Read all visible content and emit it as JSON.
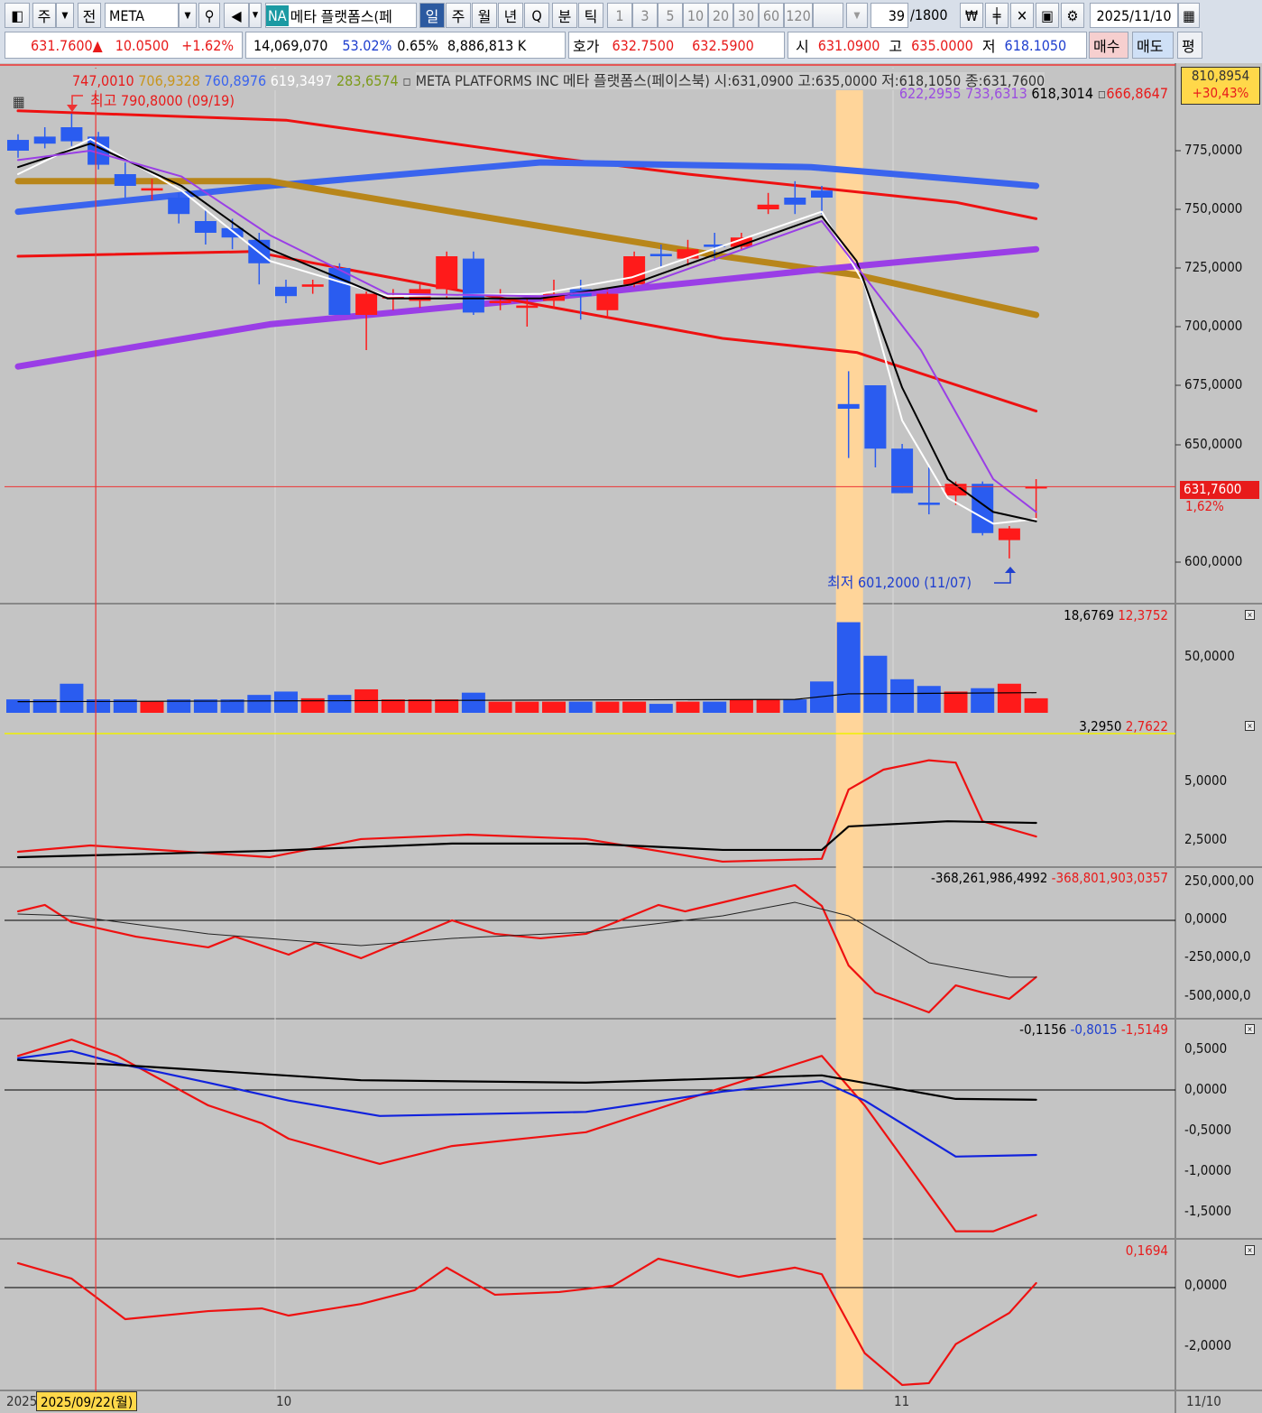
{
  "toolbar": {
    "market": "주",
    "all": "전",
    "symbol": "META",
    "na_badge": "NA",
    "name": "메타 플랫폼스(페",
    "periods": [
      "일",
      "주",
      "월",
      "년",
      "Q",
      "분",
      "틱"
    ],
    "minutes": [
      "1",
      "3",
      "5",
      "10",
      "20",
      "30",
      "60",
      "120"
    ],
    "count": "39",
    "count_total": "/1800",
    "date": "2025/11/10"
  },
  "quote": {
    "price": "631.7600▲",
    "change": "10.0500",
    "change_pct": "+1.62%",
    "volume": "14,069,070",
    "ratio": "53.02%",
    "turnover": "0.65%",
    "amount": "8,886,813 K",
    "ask_label": "호가",
    "ask": "632.7500",
    "bid": "632.5900",
    "open_label": "시",
    "open": "631.0900",
    "high_label": "고",
    "high": "635.0000",
    "low_label": "저",
    "low": "618.1050",
    "buy": "매수",
    "sell": "매도",
    "avg": "평"
  },
  "legend": {
    "ma1": "747,0010",
    "ma2": "706,9328",
    "ma3": "760,8976",
    "ma4": "619,3497",
    "ma5": "283,6574",
    "title": "META PLATFORMS INC  메타 플랫폼스(페이스북) 시:631,0900 고:635,0000 저:618,1050 종:631,7600",
    "ma6": "622,2955",
    "ma7": "733,6313",
    "ma8": "618,3014",
    "ma9": "666,8647"
  },
  "annotations": {
    "high": "최고 790,8000 (09/19)",
    "low": "최저 601,2000 (11/07)",
    "top_box_value": "810,8954",
    "top_box_pct": "+30,43%",
    "current_price": "631,7600",
    "current_pct": "1,62%"
  },
  "price_axis": [
    "775,0000",
    "750,0000",
    "725,0000",
    "700,0000",
    "675,0000",
    "650,0000",
    "600,0000"
  ],
  "panels": {
    "volume": {
      "values": [
        "18,6769",
        "12,3752"
      ],
      "axis": [
        "50,0000"
      ]
    },
    "p3": {
      "values": [
        "3,2950",
        "2,7622"
      ],
      "axis": [
        "5,0000",
        "2,5000"
      ]
    },
    "p4": {
      "values": [
        "-368,261,986,4992",
        "-368,801,903,0357"
      ],
      "axis": [
        "250,000,00",
        "0,0000",
        "-250,000,0",
        "-500,000,0"
      ]
    },
    "p5": {
      "values": [
        "-0,1156",
        "-0,8015",
        "-1,5149"
      ],
      "axis": [
        "0,5000",
        "0,0000",
        "-0,5000",
        "-1,0000",
        "-1,5000"
      ]
    },
    "p6": {
      "values": [
        "0,1694"
      ],
      "axis": [
        "0,0000",
        "-2,0000"
      ]
    }
  },
  "x_axis": {
    "start": "2025",
    "crosshair_date": "2025/09/22(월)",
    "oct": "10",
    "nov": "11",
    "end": "11/10"
  },
  "colors": {
    "up": "#ff1a1a",
    "down": "#2a5cf0",
    "bg": "#c4c4c4"
  },
  "chart_data": {
    "type": "candlestick",
    "highlight_bar": 31,
    "crosshair_bar": 2.9,
    "ohlc": [
      [
        779.6,
        782,
        772,
        775
      ],
      [
        781,
        785,
        776,
        778
      ],
      [
        785,
        790.8,
        777,
        779
      ],
      [
        781,
        783,
        767,
        769
      ],
      [
        765,
        770,
        755,
        760
      ],
      [
        758,
        763,
        754,
        759
      ],
      [
        755,
        757,
        744,
        748
      ],
      [
        745,
        750,
        735,
        740
      ],
      [
        742,
        746,
        733,
        738
      ],
      [
        737,
        740,
        718,
        727
      ],
      [
        717,
        720,
        710,
        713
      ],
      [
        717,
        720,
        714,
        718
      ],
      [
        725,
        727,
        705,
        705
      ],
      [
        705,
        715,
        690,
        714
      ],
      [
        712,
        716,
        707,
        713
      ],
      [
        711,
        718,
        708,
        716
      ],
      [
        716,
        732,
        712,
        730
      ],
      [
        729,
        732,
        705,
        706
      ],
      [
        710,
        716,
        707,
        711
      ],
      [
        708,
        712,
        700,
        709
      ],
      [
        711,
        720,
        708,
        714
      ],
      [
        716,
        720,
        703,
        713
      ],
      [
        707,
        716,
        704,
        714
      ],
      [
        718,
        732,
        716,
        730
      ],
      [
        731,
        735,
        725,
        730
      ],
      [
        729,
        737,
        726,
        733
      ],
      [
        735,
        740,
        728,
        734
      ],
      [
        734,
        740,
        733,
        738
      ],
      [
        750,
        757,
        748,
        752
      ],
      [
        755,
        762,
        748,
        752
      ],
      [
        758,
        760,
        748,
        755
      ],
      [
        667,
        681,
        644,
        665
      ],
      [
        675,
        675,
        640,
        648
      ],
      [
        648,
        650,
        629,
        629
      ],
      [
        625,
        640,
        620,
        624
      ],
      [
        628,
        634,
        624,
        633
      ],
      [
        633,
        634,
        611,
        612
      ],
      [
        609,
        615,
        601.2,
        614
      ],
      [
        631.09,
        635,
        618.105,
        631.76
      ]
    ],
    "overlays": [
      {
        "name": "upper-band",
        "color": "#ee1111",
        "w": 3,
        "pts": [
          [
            0,
            792
          ],
          [
            10,
            788
          ],
          [
            15,
            780
          ],
          [
            20,
            772
          ],
          [
            25,
            765
          ],
          [
            30,
            759
          ],
          [
            35,
            753
          ],
          [
            38,
            746
          ]
        ]
      },
      {
        "name": "blue-ma",
        "color": "#3a64ee",
        "w": 7,
        "pts": [
          [
            0,
            749
          ],
          [
            9.4,
            760
          ],
          [
            19.5,
            770
          ],
          [
            29.6,
            768
          ],
          [
            38,
            760
          ]
        ]
      },
      {
        "name": "gold-ma",
        "color": "#b8861a",
        "w": 7,
        "pts": [
          [
            0,
            762
          ],
          [
            9.4,
            762
          ],
          [
            16.2,
            749
          ],
          [
            26.3,
            730
          ],
          [
            31.3,
            722
          ],
          [
            38,
            705
          ]
        ]
      },
      {
        "name": "purple-ma",
        "color": "#9a3ee6",
        "w": 7,
        "pts": [
          [
            0,
            683
          ],
          [
            9.4,
            701
          ],
          [
            19.5,
            712
          ],
          [
            29.6,
            724
          ],
          [
            38,
            733
          ]
        ]
      },
      {
        "name": "mid-band",
        "color": "#ee1111",
        "w": 3,
        "pts": [
          [
            0,
            730
          ],
          [
            8.75,
            732
          ],
          [
            16.2,
            716
          ],
          [
            26.3,
            695
          ],
          [
            31.3,
            689
          ],
          [
            38,
            664
          ]
        ]
      },
      {
        "name": "white-ma",
        "color": "#ffffff",
        "w": 2,
        "pts": [
          [
            0,
            765
          ],
          [
            2.7,
            780
          ],
          [
            6.1,
            758
          ],
          [
            9.4,
            728
          ],
          [
            13.8,
            713
          ],
          [
            19.5,
            714
          ],
          [
            22.9,
            721
          ],
          [
            30,
            749
          ],
          [
            31.6,
            718
          ],
          [
            33,
            660
          ],
          [
            34.7,
            627
          ],
          [
            36.4,
            616
          ],
          [
            38,
            618
          ]
        ]
      },
      {
        "name": "black-ma",
        "color": "#000000",
        "w": 2,
        "pts": [
          [
            0,
            768
          ],
          [
            2.7,
            778
          ],
          [
            6.1,
            760
          ],
          [
            9.4,
            733
          ],
          [
            13.8,
            712
          ],
          [
            19.5,
            712
          ],
          [
            22.9,
            718
          ],
          [
            30,
            747
          ],
          [
            31.3,
            728
          ],
          [
            33,
            674
          ],
          [
            34.7,
            635
          ],
          [
            36.4,
            621
          ],
          [
            38,
            617
          ]
        ]
      },
      {
        "name": "purple-thin-ma",
        "color": "#9a3ee6",
        "w": 2,
        "pts": [
          [
            0,
            771
          ],
          [
            2.7,
            775
          ],
          [
            6.1,
            764
          ],
          [
            9.4,
            739
          ],
          [
            13.8,
            714
          ],
          [
            19.5,
            713
          ],
          [
            22.9,
            716
          ],
          [
            30,
            745
          ],
          [
            33.7,
            690
          ],
          [
            36.4,
            635
          ],
          [
            38,
            621
          ]
        ]
      }
    ],
    "volume": [
      12,
      12,
      26,
      12,
      12,
      10,
      12,
      12,
      12,
      16,
      19,
      13,
      16,
      21,
      12,
      12,
      12,
      18,
      10,
      10,
      10,
      10,
      10,
      10,
      8,
      10,
      10,
      12,
      12,
      12,
      28,
      81,
      51,
      30,
      24,
      19,
      22,
      26,
      13
    ],
    "volume_ma": [
      [
        0,
        10
      ],
      [
        29,
        12
      ],
      [
        31,
        17
      ],
      [
        38,
        18
      ]
    ],
    "p3": [
      {
        "color": "#ee1111",
        "pts": [
          [
            0,
            2.0
          ],
          [
            2.7,
            2.27
          ],
          [
            9.4,
            1.77
          ],
          [
            12.8,
            2.54
          ],
          [
            16.8,
            2.73
          ],
          [
            21.2,
            2.54
          ],
          [
            26.3,
            1.58
          ],
          [
            30,
            1.7
          ],
          [
            31,
            4.65
          ],
          [
            32.3,
            5.5
          ],
          [
            34,
            5.9
          ],
          [
            35,
            5.8
          ],
          [
            36,
            3.3
          ],
          [
            38,
            2.65
          ]
        ]
      },
      {
        "color": "#000000",
        "pts": [
          [
            0,
            1.77
          ],
          [
            9.4,
            2.04
          ],
          [
            16.2,
            2.35
          ],
          [
            21.2,
            2.35
          ],
          [
            26.3,
            2.08
          ],
          [
            30,
            2.08
          ],
          [
            31,
            3.08
          ],
          [
            34.7,
            3.3
          ],
          [
            38,
            3.23
          ]
        ]
      }
    ],
    "p4": [
      {
        "color": "#ee1111",
        "pts": [
          [
            0,
            58
          ],
          [
            1,
            99
          ],
          [
            2,
            -12
          ],
          [
            4.4,
            -105
          ],
          [
            7.1,
            -174
          ],
          [
            8.1,
            -105
          ],
          [
            10.1,
            -221
          ],
          [
            11.1,
            -145
          ],
          [
            12.8,
            -244
          ],
          [
            16.2,
            0
          ],
          [
            17.8,
            -87
          ],
          [
            19.5,
            -116
          ],
          [
            21.2,
            -87
          ],
          [
            22.9,
            29
          ],
          [
            23.9,
            99
          ],
          [
            24.9,
            58
          ],
          [
            29,
            227
          ],
          [
            30,
            93
          ],
          [
            31,
            -291
          ],
          [
            32,
            -465
          ],
          [
            34,
            -593
          ],
          [
            35,
            -419
          ],
          [
            36,
            -465
          ],
          [
            37,
            -506
          ],
          [
            38,
            -366
          ]
        ]
      },
      {
        "color": "#222222",
        "pts": [
          [
            0,
            41
          ],
          [
            2,
            29
          ],
          [
            7.1,
            -87
          ],
          [
            12.8,
            -163
          ],
          [
            16.2,
            -116
          ],
          [
            21.2,
            -76
          ],
          [
            26.3,
            29
          ],
          [
            29,
            116
          ],
          [
            31,
            29
          ],
          [
            34,
            -273
          ],
          [
            37,
            -366
          ],
          [
            38,
            -366
          ]
        ]
      }
    ],
    "p5": [
      {
        "color": "#ee1111",
        "pts": [
          [
            0,
            0.42
          ],
          [
            2,
            0.62
          ],
          [
            3.7,
            0.42
          ],
          [
            7.1,
            -0.19
          ],
          [
            9.1,
            -0.41
          ],
          [
            10.1,
            -0.6
          ],
          [
            13.5,
            -0.91
          ],
          [
            16.2,
            -0.69
          ],
          [
            21.2,
            -0.52
          ],
          [
            26.3,
            0.03
          ],
          [
            30,
            0.42
          ],
          [
            31.6,
            -0.19
          ],
          [
            35,
            -1.74
          ],
          [
            36.4,
            -1.74
          ],
          [
            38,
            -1.54
          ]
        ]
      },
      {
        "color": "#1122dd",
        "pts": [
          [
            0,
            0.39
          ],
          [
            2,
            0.48
          ],
          [
            3.7,
            0.33
          ],
          [
            7.1,
            0.09
          ],
          [
            10.1,
            -0.13
          ],
          [
            13.5,
            -0.32
          ],
          [
            21.2,
            -0.27
          ],
          [
            26.3,
            -0.02
          ],
          [
            30,
            0.11
          ],
          [
            31.6,
            -0.13
          ],
          [
            35,
            -0.82
          ],
          [
            38,
            -0.8
          ]
        ]
      },
      {
        "color": "#000000",
        "pts": [
          [
            0,
            0.37
          ],
          [
            3.7,
            0.31
          ],
          [
            12.8,
            0.12
          ],
          [
            21.2,
            0.09
          ],
          [
            30,
            0.18
          ],
          [
            35,
            -0.11
          ],
          [
            38,
            -0.12
          ]
        ]
      }
    ],
    "p6": [
      {
        "color": "#ee1111",
        "pts": [
          [
            0,
            0.82
          ],
          [
            2,
            0.3
          ],
          [
            4,
            -1.06
          ],
          [
            7.1,
            -0.79
          ],
          [
            9.1,
            -0.7
          ],
          [
            10.1,
            -0.94
          ],
          [
            12.8,
            -0.55
          ],
          [
            14.8,
            -0.09
          ],
          [
            16,
            0.67
          ],
          [
            17.8,
            -0.24
          ],
          [
            20.2,
            -0.15
          ],
          [
            22.2,
            0.06
          ],
          [
            23.9,
            0.97
          ],
          [
            26.9,
            0.36
          ],
          [
            29,
            0.67
          ],
          [
            30,
            0.45
          ],
          [
            31.6,
            -2.2
          ],
          [
            33,
            -3.27
          ],
          [
            34,
            -3.21
          ],
          [
            35,
            -1.9
          ],
          [
            37,
            -0.85
          ],
          [
            38,
            0.15
          ]
        ]
      }
    ]
  }
}
